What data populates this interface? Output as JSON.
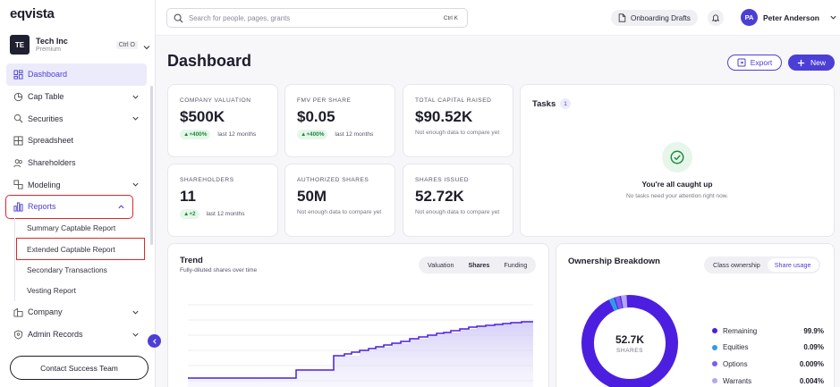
{
  "app": {
    "logo": "eqvista"
  },
  "org": {
    "initials": "TE",
    "name": "Tech Inc",
    "plan": "Premium",
    "shortcut": "Ctrl O"
  },
  "sidebar": {
    "items": [
      {
        "label": "Dashboard",
        "icon": "dashboard-icon"
      },
      {
        "label": "Cap Table",
        "icon": "pie-chart-icon"
      },
      {
        "label": "Securities",
        "icon": "securities-icon"
      },
      {
        "label": "Spreadsheet",
        "icon": "grid-icon"
      },
      {
        "label": "Shareholders",
        "icon": "users-icon"
      },
      {
        "label": "Modeling",
        "icon": "modeling-icon"
      },
      {
        "label": "Reports",
        "icon": "bar-chart-icon"
      }
    ],
    "report_subitems": [
      "Summary Captable Report",
      "Extended Captable Report",
      "Secondary Transactions",
      "Vesting Report"
    ],
    "bottom_items": [
      {
        "label": "Company",
        "icon": "company-icon"
      },
      {
        "label": "Admin Records",
        "icon": "admin-icon"
      }
    ],
    "contact_label": "Contact Success Team"
  },
  "topbar": {
    "search_placeholder": "Search for people, pages, grants",
    "search_shortcut": "Ctrl K",
    "drafts_label": "Onboarding Drafts",
    "user_initials": "PA",
    "user_name": "Peter Anderson"
  },
  "page": {
    "title": "Dashboard",
    "export_label": "Export",
    "new_label": "New"
  },
  "stats": [
    {
      "label": "COMPANY VALUATION",
      "value": "$500K",
      "badge": "▲+400%",
      "note": "last 12 months"
    },
    {
      "label": "FMV PER SHARE",
      "value": "$0.05",
      "badge": "▲+400%",
      "note": "last 12 months"
    },
    {
      "label": "TOTAL CAPITAL RAISED",
      "value": "$90.52K",
      "note": "Not enough data to compare yet"
    },
    {
      "label": "SHAREHOLDERS",
      "value": "11",
      "badge": "▲+2",
      "note": "last 12 months"
    },
    {
      "label": "AUTHORIZED SHARES",
      "value": "50M",
      "note": "Not enough data to compare yet"
    },
    {
      "label": "SHARES ISSUED",
      "value": "52.72K",
      "note": "Not enough data to compare yet"
    }
  ],
  "tasks": {
    "title": "Tasks",
    "count": "1",
    "headline": "You're all caught up",
    "subline": "No tasks need your attention right now."
  },
  "trend": {
    "title": "Trend",
    "subtitle": "Fully-diluted shares over time",
    "tabs": [
      "Valuation",
      "Shares",
      "Funding"
    ],
    "active_tab": "Shares"
  },
  "ownership": {
    "title": "Ownership Breakdown",
    "tabs": [
      "Class ownership",
      "Share usage"
    ],
    "active_tab": "Share usage",
    "center_value": "52.7K",
    "center_unit": "SHARES",
    "legend": [
      {
        "name": "Remaining",
        "value": "99.9%",
        "color": "#4c1fe0"
      },
      {
        "name": "Equities",
        "value": "0.09%",
        "color": "#2f9be8"
      },
      {
        "name": "Options",
        "value": "0.009%",
        "color": "#7b5cf0"
      },
      {
        "name": "Warrants",
        "value": "0.004%",
        "color": "#b4a6f4"
      }
    ]
  },
  "colors": {
    "accent": "#4c3fd6",
    "highlight": "#e0262e",
    "positive": "#1f8a3c"
  }
}
